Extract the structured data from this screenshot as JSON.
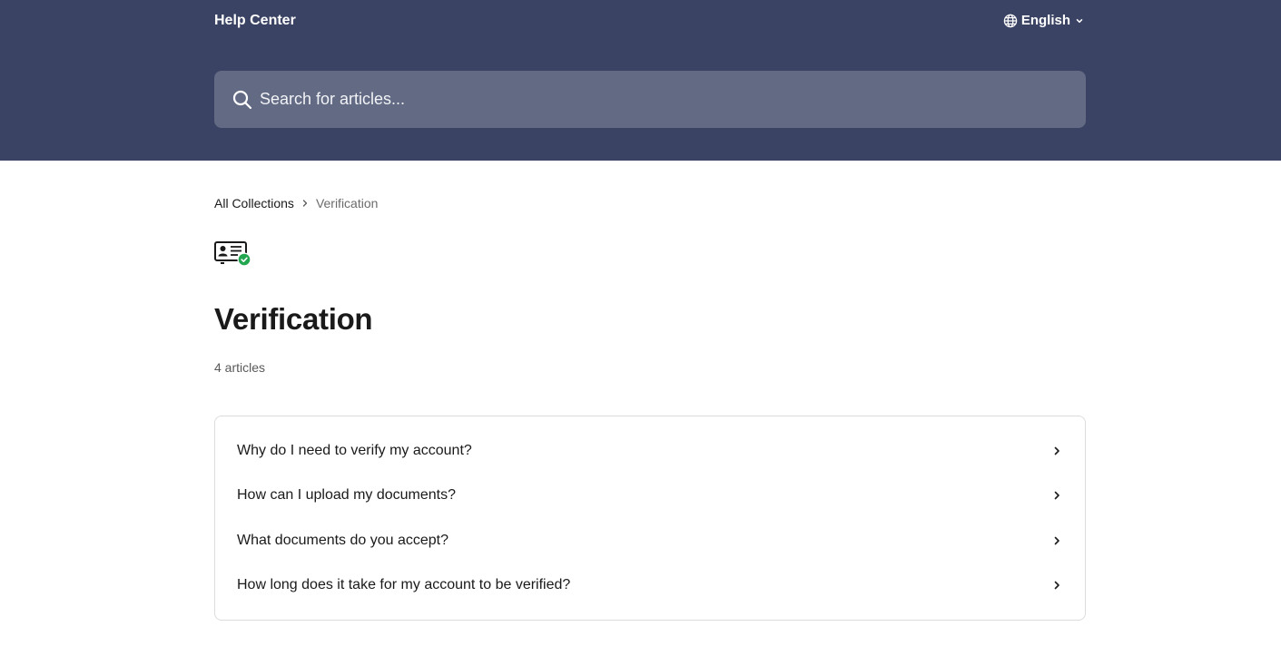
{
  "header": {
    "brand": "Help Center",
    "language": "English",
    "language_icon": "globe-icon",
    "bg_color": "#3a4364"
  },
  "search": {
    "placeholder": "Search for articles...",
    "value": "",
    "icon": "search-icon"
  },
  "breadcrumb": {
    "items": [
      {
        "label": "All Collections"
      },
      {
        "label": "Verification"
      }
    ]
  },
  "collection": {
    "icon": "id-card-verified-icon",
    "title": "Verification",
    "article_count": "4 articles",
    "articles": [
      {
        "title": "Why do I need to verify my account?"
      },
      {
        "title": "How can I upload my documents?"
      },
      {
        "title": "What documents do you accept?"
      },
      {
        "title": "How long does it take for my account to be verified?"
      }
    ]
  },
  "colors": {
    "accent_check": "#22a650"
  }
}
